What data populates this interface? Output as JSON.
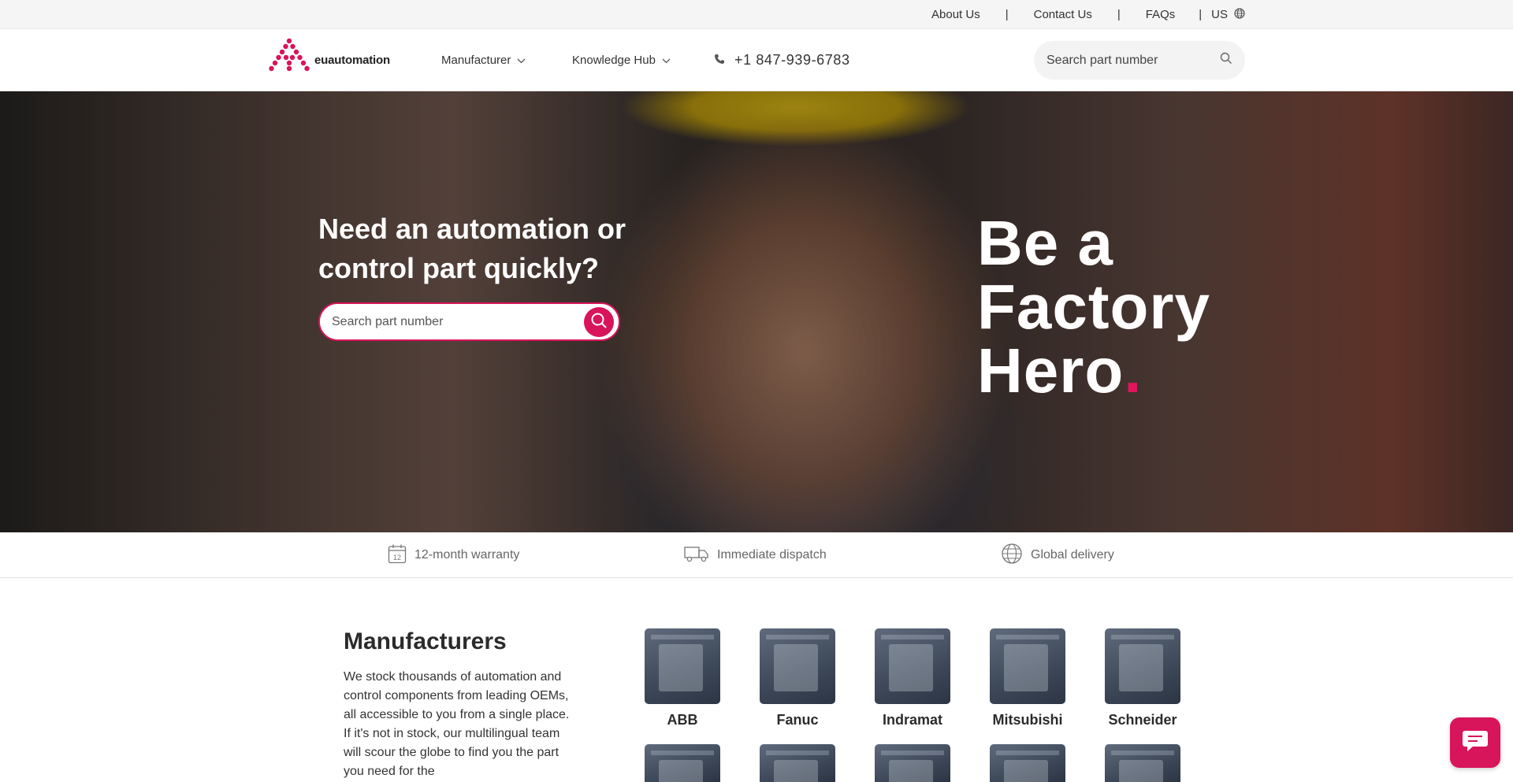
{
  "topbar": {
    "about": "About Us",
    "contact": "Contact Us",
    "faqs": "FAQs",
    "separator": "|",
    "region": "US"
  },
  "header": {
    "logo_text": "euautomation",
    "nav": {
      "manufacturer": "Manufacturer",
      "knowledge_hub": "Knowledge Hub"
    },
    "phone": "+1 847-939-6783",
    "search_placeholder": "Search part number"
  },
  "hero": {
    "heading": "Need an automation or control part quickly?",
    "search_placeholder": "Search part number",
    "tag_line1": "Be a",
    "tag_line2": "Factory",
    "tag_line3": "Hero",
    "tag_dot": "."
  },
  "features": {
    "warranty": "12-month warranty",
    "warranty_icon_number": "12",
    "dispatch": "Immediate dispatch",
    "delivery": "Global delivery"
  },
  "manufacturers": {
    "title": "Manufacturers",
    "description": "We stock thousands of automation and control components from leading OEMs, all accessible to you from a single place. If it's not in stock, our multilingual team will scour the globe to find you the part you need for the",
    "brands": [
      "ABB",
      "Fanuc",
      "Indramat",
      "Mitsubishi",
      "Schneider"
    ]
  },
  "colors": {
    "brand": "#d8145a",
    "text_dark": "#2b2b2b",
    "topbar_bg": "#f5f5f5"
  },
  "icons": [
    "globe-icon",
    "chevron-down-icon",
    "phone-icon",
    "search-icon",
    "calendar-icon",
    "truck-icon",
    "chat-icon"
  ]
}
